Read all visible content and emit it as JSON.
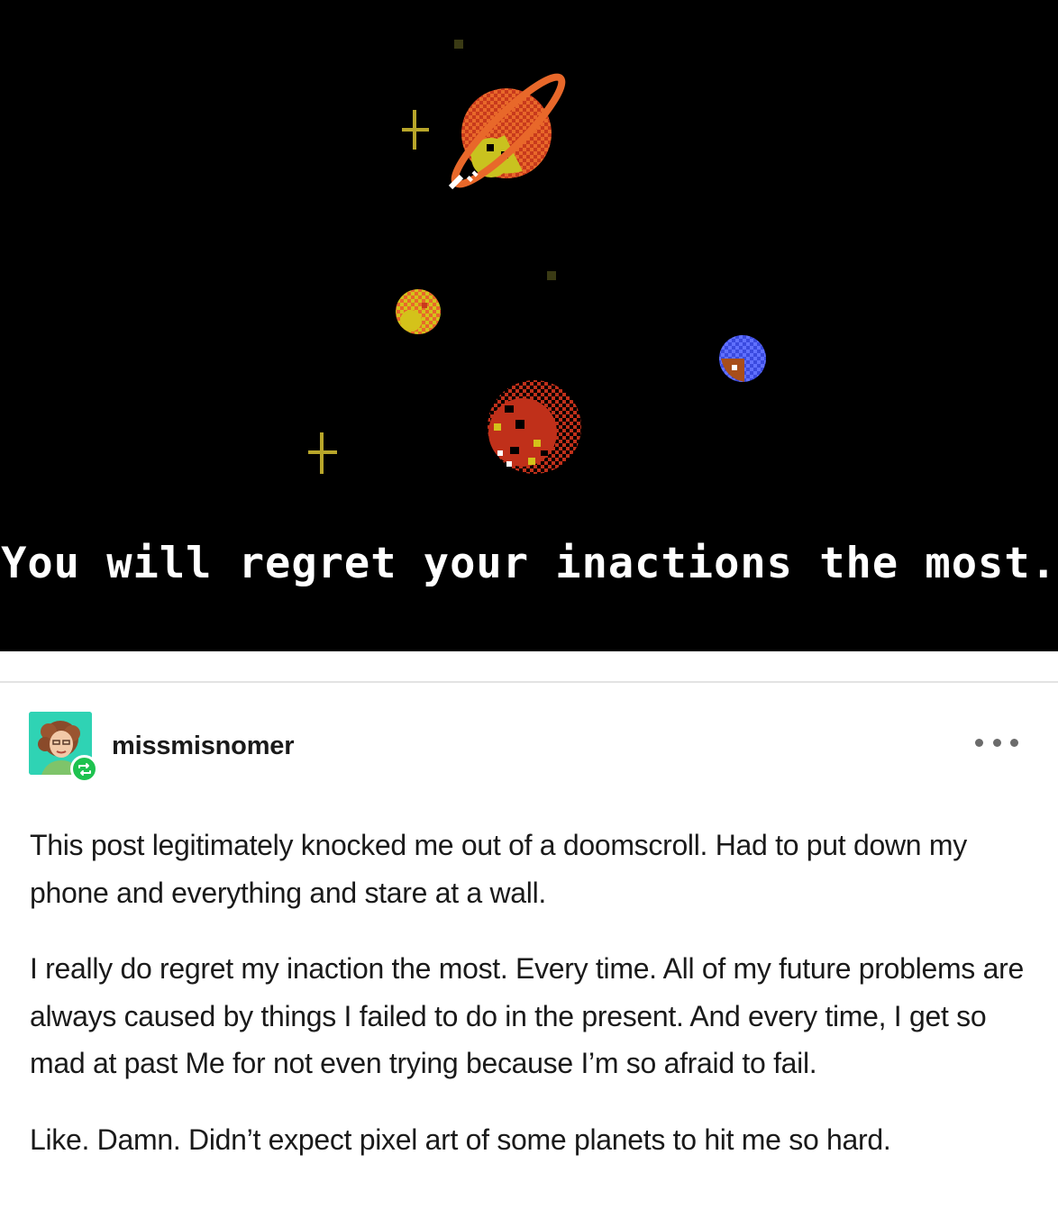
{
  "image": {
    "caption": "You will regret your inactions the most.",
    "background_color": "#000000",
    "elements": [
      "ringed-planet",
      "small-planet",
      "blue-planet",
      "red-planet",
      "star-sparkle"
    ]
  },
  "post": {
    "username": "missmisnomer",
    "avatar_icon": "avatar-illustration-icon",
    "reblog_icon": "reblog-icon",
    "more_icon": "more-options-icon",
    "paragraphs": [
      "This post legitimately knocked me out of a doomscroll. Had to put down my phone and everything and stare at a wall.",
      "I really do regret my inaction the most. Every time. All of my future problems are always caused by things I failed to do in the present. And every time, I get so mad at past Me for not even trying because I’m so afraid to fail.",
      "Like. Damn. Didn’t expect pixel art of some planets to hit me so hard."
    ]
  },
  "colors": {
    "reblog_badge": "#1ec24f",
    "avatar_bg": "#2fd3b4",
    "divider": "#e3e3e3"
  }
}
